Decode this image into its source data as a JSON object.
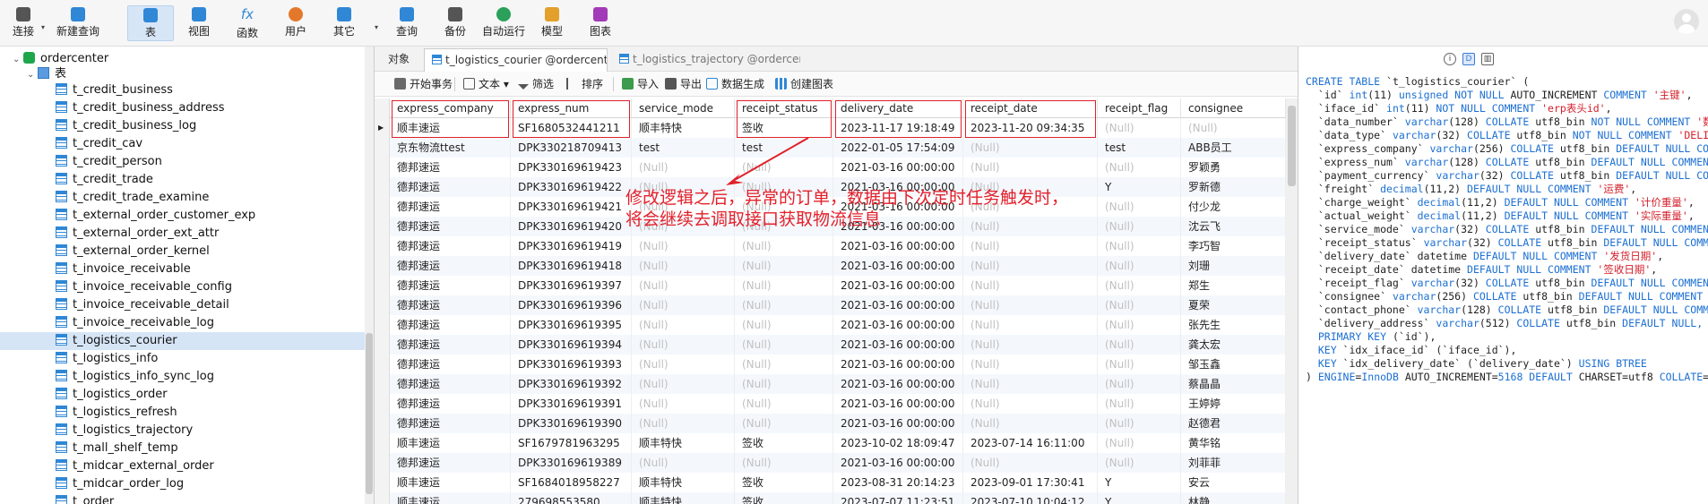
{
  "toolbar": {
    "items": [
      {
        "label": "连接",
        "icon": "plug-icon"
      },
      {
        "label": "新建查询",
        "icon": "new-query-icon"
      },
      {
        "label": "表",
        "icon": "table-icon"
      },
      {
        "label": "视图",
        "icon": "view-icon"
      },
      {
        "label": "函数",
        "icon": "function-icon"
      },
      {
        "label": "用户",
        "icon": "user-icon"
      },
      {
        "label": "其它",
        "icon": "tools-icon"
      },
      {
        "label": "查询",
        "icon": "query-icon"
      },
      {
        "label": "备份",
        "icon": "backup-icon"
      },
      {
        "label": "自动运行",
        "icon": "robot-icon"
      },
      {
        "label": "模型",
        "icon": "model-icon"
      },
      {
        "label": "图表",
        "icon": "chart-icon"
      }
    ],
    "fx_glyph": "fx"
  },
  "sidebar": {
    "database": "ordercenter",
    "schema": "表",
    "tables": [
      "t_credit_business",
      "t_credit_business_address",
      "t_credit_business_log",
      "t_credit_cav",
      "t_credit_person",
      "t_credit_trade",
      "t_credit_trade_examine",
      "t_external_order_customer_exp",
      "t_external_order_ext_attr",
      "t_external_order_kernel",
      "t_invoice_receivable",
      "t_invoice_receivable_config",
      "t_invoice_receivable_detail",
      "t_invoice_receivable_log",
      "t_logistics_courier",
      "t_logistics_info",
      "t_logistics_info_sync_log",
      "t_logistics_order",
      "t_logistics_refresh",
      "t_logistics_trajectory",
      "t_mall_shelf_temp",
      "t_midcar_external_order",
      "t_midcar_order_log",
      "t_order"
    ],
    "selected_index": 14
  },
  "tabs": [
    {
      "label": "对象"
    },
    {
      "label": "t_logistics_courier @ordercenter (开..."
    },
    {
      "label": "t_logistics_trajectory @ordercenter (..."
    }
  ],
  "subbar": {
    "begin_tx": "开始事务",
    "text": "文本",
    "filter": "筛选",
    "sort": "排序",
    "import": "导入",
    "export": "导出",
    "generate": "数据生成",
    "create_chart": "创建图表"
  },
  "grid": {
    "columns": [
      "express_company",
      "express_num",
      "service_mode",
      "receipt_status",
      "delivery_date",
      "receipt_date",
      "receipt_flag",
      "consignee"
    ],
    "null_text": "(Null)",
    "rows": [
      [
        "顺丰速运",
        "SF1680532441211",
        "顺丰特快",
        "签收",
        "2023-11-17 19:18:49",
        "2023-11-20 09:34:35",
        null,
        null
      ],
      [
        "京东物流ttest",
        "DPK330218709413",
        "test",
        "test",
        "2022-01-05 17:54:09",
        null,
        "test",
        "ABB员工"
      ],
      [
        "德邦速运",
        "DPK330169619423",
        null,
        null,
        "2021-03-16 00:00:00",
        null,
        null,
        "罗颖勇"
      ],
      [
        "德邦速运",
        "DPK330169619422",
        null,
        null,
        "2021-03-16 00:00:00",
        null,
        "Y",
        "罗新德"
      ],
      [
        "德邦速运",
        "DPK330169619421",
        null,
        null,
        "2021-03-16 00:00:00",
        null,
        null,
        "付少龙"
      ],
      [
        "德邦速运",
        "DPK330169619420",
        null,
        null,
        "2021-03-16 00:00:00",
        null,
        null,
        "沈云飞"
      ],
      [
        "德邦速运",
        "DPK330169619419",
        null,
        null,
        "2021-03-16 00:00:00",
        null,
        null,
        "李巧智"
      ],
      [
        "德邦速运",
        "DPK330169619418",
        null,
        null,
        "2021-03-16 00:00:00",
        null,
        null,
        "刘珊"
      ],
      [
        "德邦速运",
        "DPK330169619397",
        null,
        null,
        "2021-03-16 00:00:00",
        null,
        null,
        "郑生"
      ],
      [
        "德邦速运",
        "DPK330169619396",
        null,
        null,
        "2021-03-16 00:00:00",
        null,
        null,
        "夏荣"
      ],
      [
        "德邦速运",
        "DPK330169619395",
        null,
        null,
        "2021-03-16 00:00:00",
        null,
        null,
        "张先生"
      ],
      [
        "德邦速运",
        "DPK330169619394",
        null,
        null,
        "2021-03-16 00:00:00",
        null,
        null,
        "龚太宏"
      ],
      [
        "德邦速运",
        "DPK330169619393",
        null,
        null,
        "2021-03-16 00:00:00",
        null,
        null,
        "邹玉鑫"
      ],
      [
        "德邦速运",
        "DPK330169619392",
        null,
        null,
        "2021-03-16 00:00:00",
        null,
        null,
        "蔡晶晶"
      ],
      [
        "德邦速运",
        "DPK330169619391",
        null,
        null,
        "2021-03-16 00:00:00",
        null,
        null,
        "王婷婷"
      ],
      [
        "德邦速运",
        "DPK330169619390",
        null,
        null,
        "2021-03-16 00:00:00",
        null,
        null,
        "赵德君"
      ],
      [
        "顺丰速运",
        "SF1679781963295",
        "顺丰特快",
        "签收",
        "2023-10-02 18:09:47",
        "2023-07-14 16:11:00",
        null,
        "黄华铭"
      ],
      [
        "德邦速运",
        "DPK330169619389",
        null,
        null,
        "2021-03-16 00:00:00",
        null,
        null,
        "刘菲菲"
      ],
      [
        "顺丰速运",
        "SF1684018958227",
        "顺丰特快",
        "签收",
        "2023-08-31 20:14:23",
        "2023-09-01 17:30:41",
        "Y",
        "安云"
      ],
      [
        "顺丰速运",
        "279698553580",
        "顺丰特快",
        "签收",
        "2023-07-07 11:23:51",
        "2023-07-10 10:04:12",
        "Y",
        "林静"
      ]
    ]
  },
  "annotation": {
    "line1": "修改逻辑之后，异常的订单，数据由下次定时任务触发时，",
    "line2": "将会继续去调取接口获取物流信息"
  },
  "ddl": {
    "tools": [
      "info-icon",
      "ddl-icon",
      "layout-icon"
    ],
    "lines": [
      [
        [
          "kw",
          "CREATE TABLE "
        ],
        [
          "t",
          "`t_logistics_courier` ("
        ]
      ],
      [
        [
          "t",
          "  `id` "
        ],
        [
          "kw",
          "int"
        ],
        [
          "t",
          "(11) "
        ],
        [
          "kw",
          "unsigned NOT NULL"
        ],
        [
          "t",
          " AUTO_INCREMENT "
        ],
        [
          "kw",
          "COMMENT "
        ],
        [
          "str",
          "'主键'"
        ],
        [
          "t",
          ","
        ]
      ],
      [
        [
          "t",
          "  `iface_id` "
        ],
        [
          "kw",
          "int"
        ],
        [
          "t",
          "(11) "
        ],
        [
          "kw",
          "NOT NULL COMMENT "
        ],
        [
          "str",
          "'erp表头id'"
        ],
        [
          "t",
          ","
        ]
      ],
      [
        [
          "t",
          "  `data_number` "
        ],
        [
          "kw",
          "varchar"
        ],
        [
          "t",
          "(128) "
        ],
        [
          "kw",
          "COLLATE"
        ],
        [
          "t",
          " utf8_bin "
        ],
        [
          "kw",
          "NOT NULL COMMENT "
        ],
        [
          "str",
          "'数据编号'"
        ],
        [
          "t",
          ","
        ]
      ],
      [
        [
          "t",
          "  `data_type` "
        ],
        [
          "kw",
          "varchar"
        ],
        [
          "t",
          "(32) "
        ],
        [
          "kw",
          "COLLATE"
        ],
        [
          "t",
          " utf8_bin "
        ],
        [
          "kw",
          "NOT NULL COMMENT "
        ],
        [
          "str",
          "'DELIVERY'"
        ],
        [
          "t",
          ","
        ]
      ],
      [
        [
          "t",
          "  `express_company` "
        ],
        [
          "kw",
          "varchar"
        ],
        [
          "t",
          "(256) "
        ],
        [
          "kw",
          "COLLATE"
        ],
        [
          "t",
          " utf8_bin "
        ],
        [
          "kw",
          "DEFAULT NULL COMMENT "
        ],
        [
          "str",
          "'快递公司'"
        ],
        [
          "t",
          ","
        ]
      ],
      [
        [
          "t",
          "  `express_num` "
        ],
        [
          "kw",
          "varchar"
        ],
        [
          "t",
          "(128) "
        ],
        [
          "kw",
          "COLLATE"
        ],
        [
          "t",
          " utf8_bin "
        ],
        [
          "kw",
          "DEFAULT NULL COMMENT "
        ],
        [
          "str",
          "'快递单号'"
        ],
        [
          "t",
          ","
        ]
      ],
      [
        [
          "t",
          "  `payment_currency` "
        ],
        [
          "kw",
          "varchar"
        ],
        [
          "t",
          "(32) "
        ],
        [
          "kw",
          "COLLATE"
        ],
        [
          "t",
          " utf8_bin "
        ],
        [
          "kw",
          "DEFAULT NULL COMMENT "
        ],
        [
          "str",
          "'币种'"
        ],
        [
          "t",
          ","
        ]
      ],
      [
        [
          "t",
          "  `freight` "
        ],
        [
          "kw",
          "decimal"
        ],
        [
          "t",
          "(11,2) "
        ],
        [
          "kw",
          "DEFAULT NULL COMMENT "
        ],
        [
          "str",
          "'运费'"
        ],
        [
          "t",
          ","
        ]
      ],
      [
        [
          "t",
          "  `charge_weight` "
        ],
        [
          "kw",
          "decimal"
        ],
        [
          "t",
          "(11,2) "
        ],
        [
          "kw",
          "DEFAULT NULL COMMENT "
        ],
        [
          "str",
          "'计价重量'"
        ],
        [
          "t",
          ","
        ]
      ],
      [
        [
          "t",
          "  `actual_weight` "
        ],
        [
          "kw",
          "decimal"
        ],
        [
          "t",
          "(11,2) "
        ],
        [
          "kw",
          "DEFAULT NULL COMMENT "
        ],
        [
          "str",
          "'实际重量'"
        ],
        [
          "t",
          ","
        ]
      ],
      [
        [
          "t",
          "  `service_mode` "
        ],
        [
          "kw",
          "varchar"
        ],
        [
          "t",
          "(32) "
        ],
        [
          "kw",
          "COLLATE"
        ],
        [
          "t",
          " utf8_bin "
        ],
        [
          "kw",
          "DEFAULT NULL COMMENT "
        ],
        [
          "str",
          "'服务方式'"
        ],
        [
          "t",
          ","
        ]
      ],
      [
        [
          "t",
          "  `receipt_status` "
        ],
        [
          "kw",
          "varchar"
        ],
        [
          "t",
          "(32) "
        ],
        [
          "kw",
          "COLLATE"
        ],
        [
          "t",
          " utf8_bin "
        ],
        [
          "kw",
          "DEFAULT NULL COMMENT "
        ],
        [
          "str",
          "'签收状态'"
        ],
        [
          "t",
          ","
        ]
      ],
      [
        [
          "t",
          "  `delivery_date` datetime "
        ],
        [
          "kw",
          "DEFAULT NULL COMMENT "
        ],
        [
          "str",
          "'发货日期'"
        ],
        [
          "t",
          ","
        ]
      ],
      [
        [
          "t",
          "  `receipt_date` datetime "
        ],
        [
          "kw",
          "DEFAULT NULL COMMENT "
        ],
        [
          "str",
          "'签收日期'"
        ],
        [
          "t",
          ","
        ]
      ],
      [
        [
          "t",
          "  `receipt_flag` "
        ],
        [
          "kw",
          "varchar"
        ],
        [
          "t",
          "(32) "
        ],
        [
          "kw",
          "COLLATE"
        ],
        [
          "t",
          " utf8_bin "
        ],
        [
          "kw",
          "DEFAULT NULL COMMENT "
        ],
        [
          "str",
          "'签收标识'"
        ],
        [
          "t",
          ","
        ]
      ],
      [
        [
          "t",
          "  `consignee` "
        ],
        [
          "kw",
          "varchar"
        ],
        [
          "t",
          "(256) "
        ],
        [
          "kw",
          "COLLATE"
        ],
        [
          "t",
          " utf8_bin "
        ],
        [
          "kw",
          "DEFAULT NULL COMMENT "
        ],
        [
          "str",
          "'收件人'"
        ],
        [
          "t",
          ","
        ]
      ],
      [
        [
          "t",
          "  `contact_phone` "
        ],
        [
          "kw",
          "varchar"
        ],
        [
          "t",
          "(128) "
        ],
        [
          "kw",
          "COLLATE"
        ],
        [
          "t",
          " utf8_bin "
        ],
        [
          "kw",
          "DEFAULT NULL COMMENT "
        ],
        [
          "str",
          "'联系电话'"
        ],
        [
          "t",
          ","
        ]
      ],
      [
        [
          "t",
          "  `delivery_address` "
        ],
        [
          "kw",
          "varchar"
        ],
        [
          "t",
          "(512) "
        ],
        [
          "kw",
          "COLLATE"
        ],
        [
          "t",
          " utf8_bin "
        ],
        [
          "kw",
          "DEFAULT NULL,"
        ]
      ],
      [
        [
          "kw",
          "  PRIMARY KEY "
        ],
        [
          "t",
          "(`id`),"
        ]
      ],
      [
        [
          "kw",
          "  KEY "
        ],
        [
          "t",
          "`idx_iface_id` (`iface_id`),"
        ]
      ],
      [
        [
          "kw",
          "  KEY "
        ],
        [
          "t",
          "`idx_delivery_date` (`delivery_date`) "
        ],
        [
          "kw",
          "USING BTREE"
        ]
      ],
      [
        [
          "t",
          ") "
        ],
        [
          "kw",
          "ENGINE"
        ],
        [
          "t",
          "="
        ],
        [
          "kw",
          "InnoDB"
        ],
        [
          "t",
          " AUTO_INCREMENT="
        ],
        [
          "kw",
          "5168"
        ],
        [
          "kw",
          " DEFAULT"
        ],
        [
          "t",
          " CHARSET=utf8 "
        ],
        [
          "kw",
          "COLLATE"
        ],
        [
          "t",
          "=utf8_bin"
        ]
      ]
    ]
  },
  "colors": {
    "accent": "#2f87d6",
    "highlight": "#e0202a",
    "selected_row": "#d6e5f6"
  }
}
